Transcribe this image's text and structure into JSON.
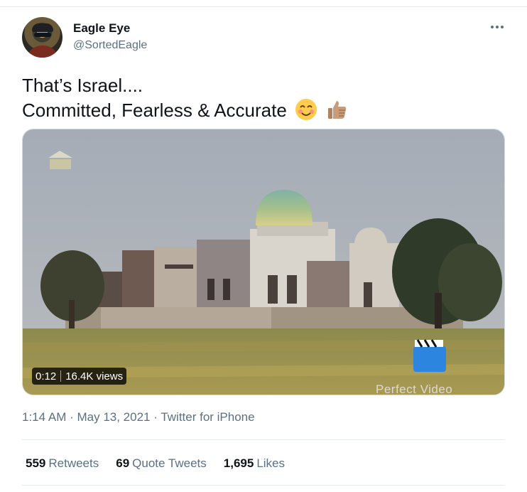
{
  "author": {
    "name": "Eagle Eye",
    "handle": "@SortedEagle"
  },
  "tweet": {
    "line1": "That’s Israel....",
    "line2": "Committed, Fearless & Accurate",
    "emojis": [
      "smiling-face-icon",
      "thumbs-up-icon"
    ]
  },
  "video": {
    "duration": "0:12",
    "views": "16.4K views",
    "watermark": "Perfect Video"
  },
  "meta": {
    "time": "1:14 AM",
    "dot1": " · ",
    "date": "May 13, 2021",
    "dot2": " · ",
    "app": "Twitter for iPhone"
  },
  "stats": {
    "retweets_count": "559",
    "retweets_label": "Retweets",
    "quote_count": "69",
    "quote_label": "Quote Tweets",
    "likes_count": "1,695",
    "likes_label": "Likes"
  }
}
